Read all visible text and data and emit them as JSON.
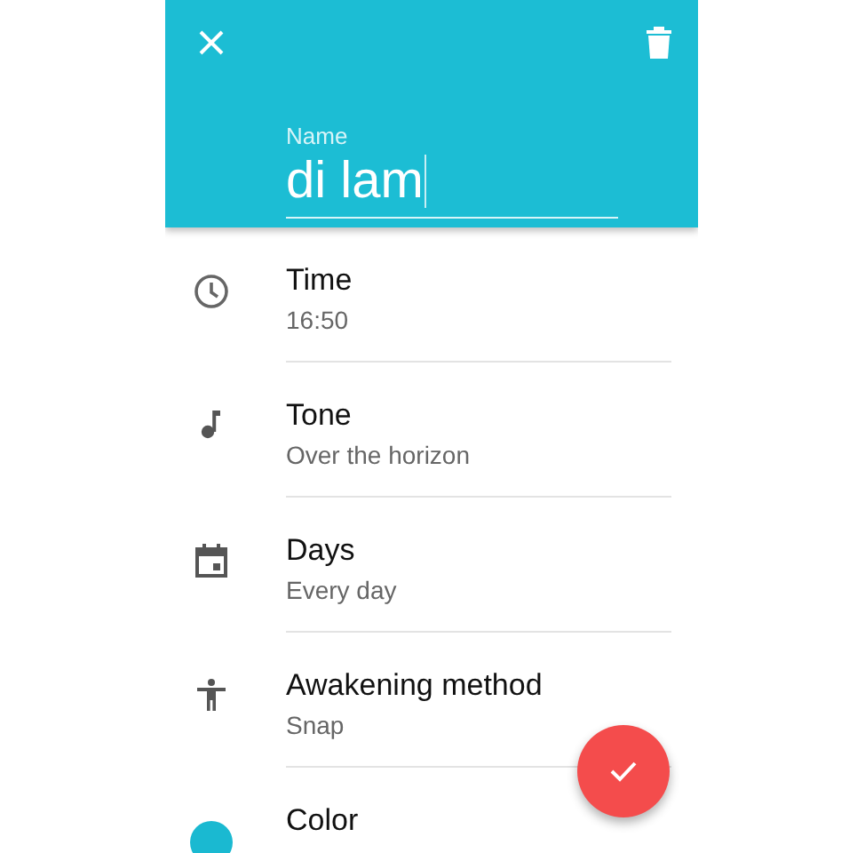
{
  "header": {
    "name_field": {
      "label": "Name",
      "value": "di lam"
    }
  },
  "items": [
    {
      "kind": "time",
      "title": "Time",
      "subtitle": "16:50"
    },
    {
      "kind": "tone",
      "title": "Tone",
      "subtitle": "Over the horizon"
    },
    {
      "kind": "days",
      "title": "Days",
      "subtitle": "Every day"
    },
    {
      "kind": "method",
      "title": "Awakening method",
      "subtitle": "Snap"
    },
    {
      "kind": "color",
      "title": "Color",
      "color": "#1ab9d1"
    }
  ]
}
